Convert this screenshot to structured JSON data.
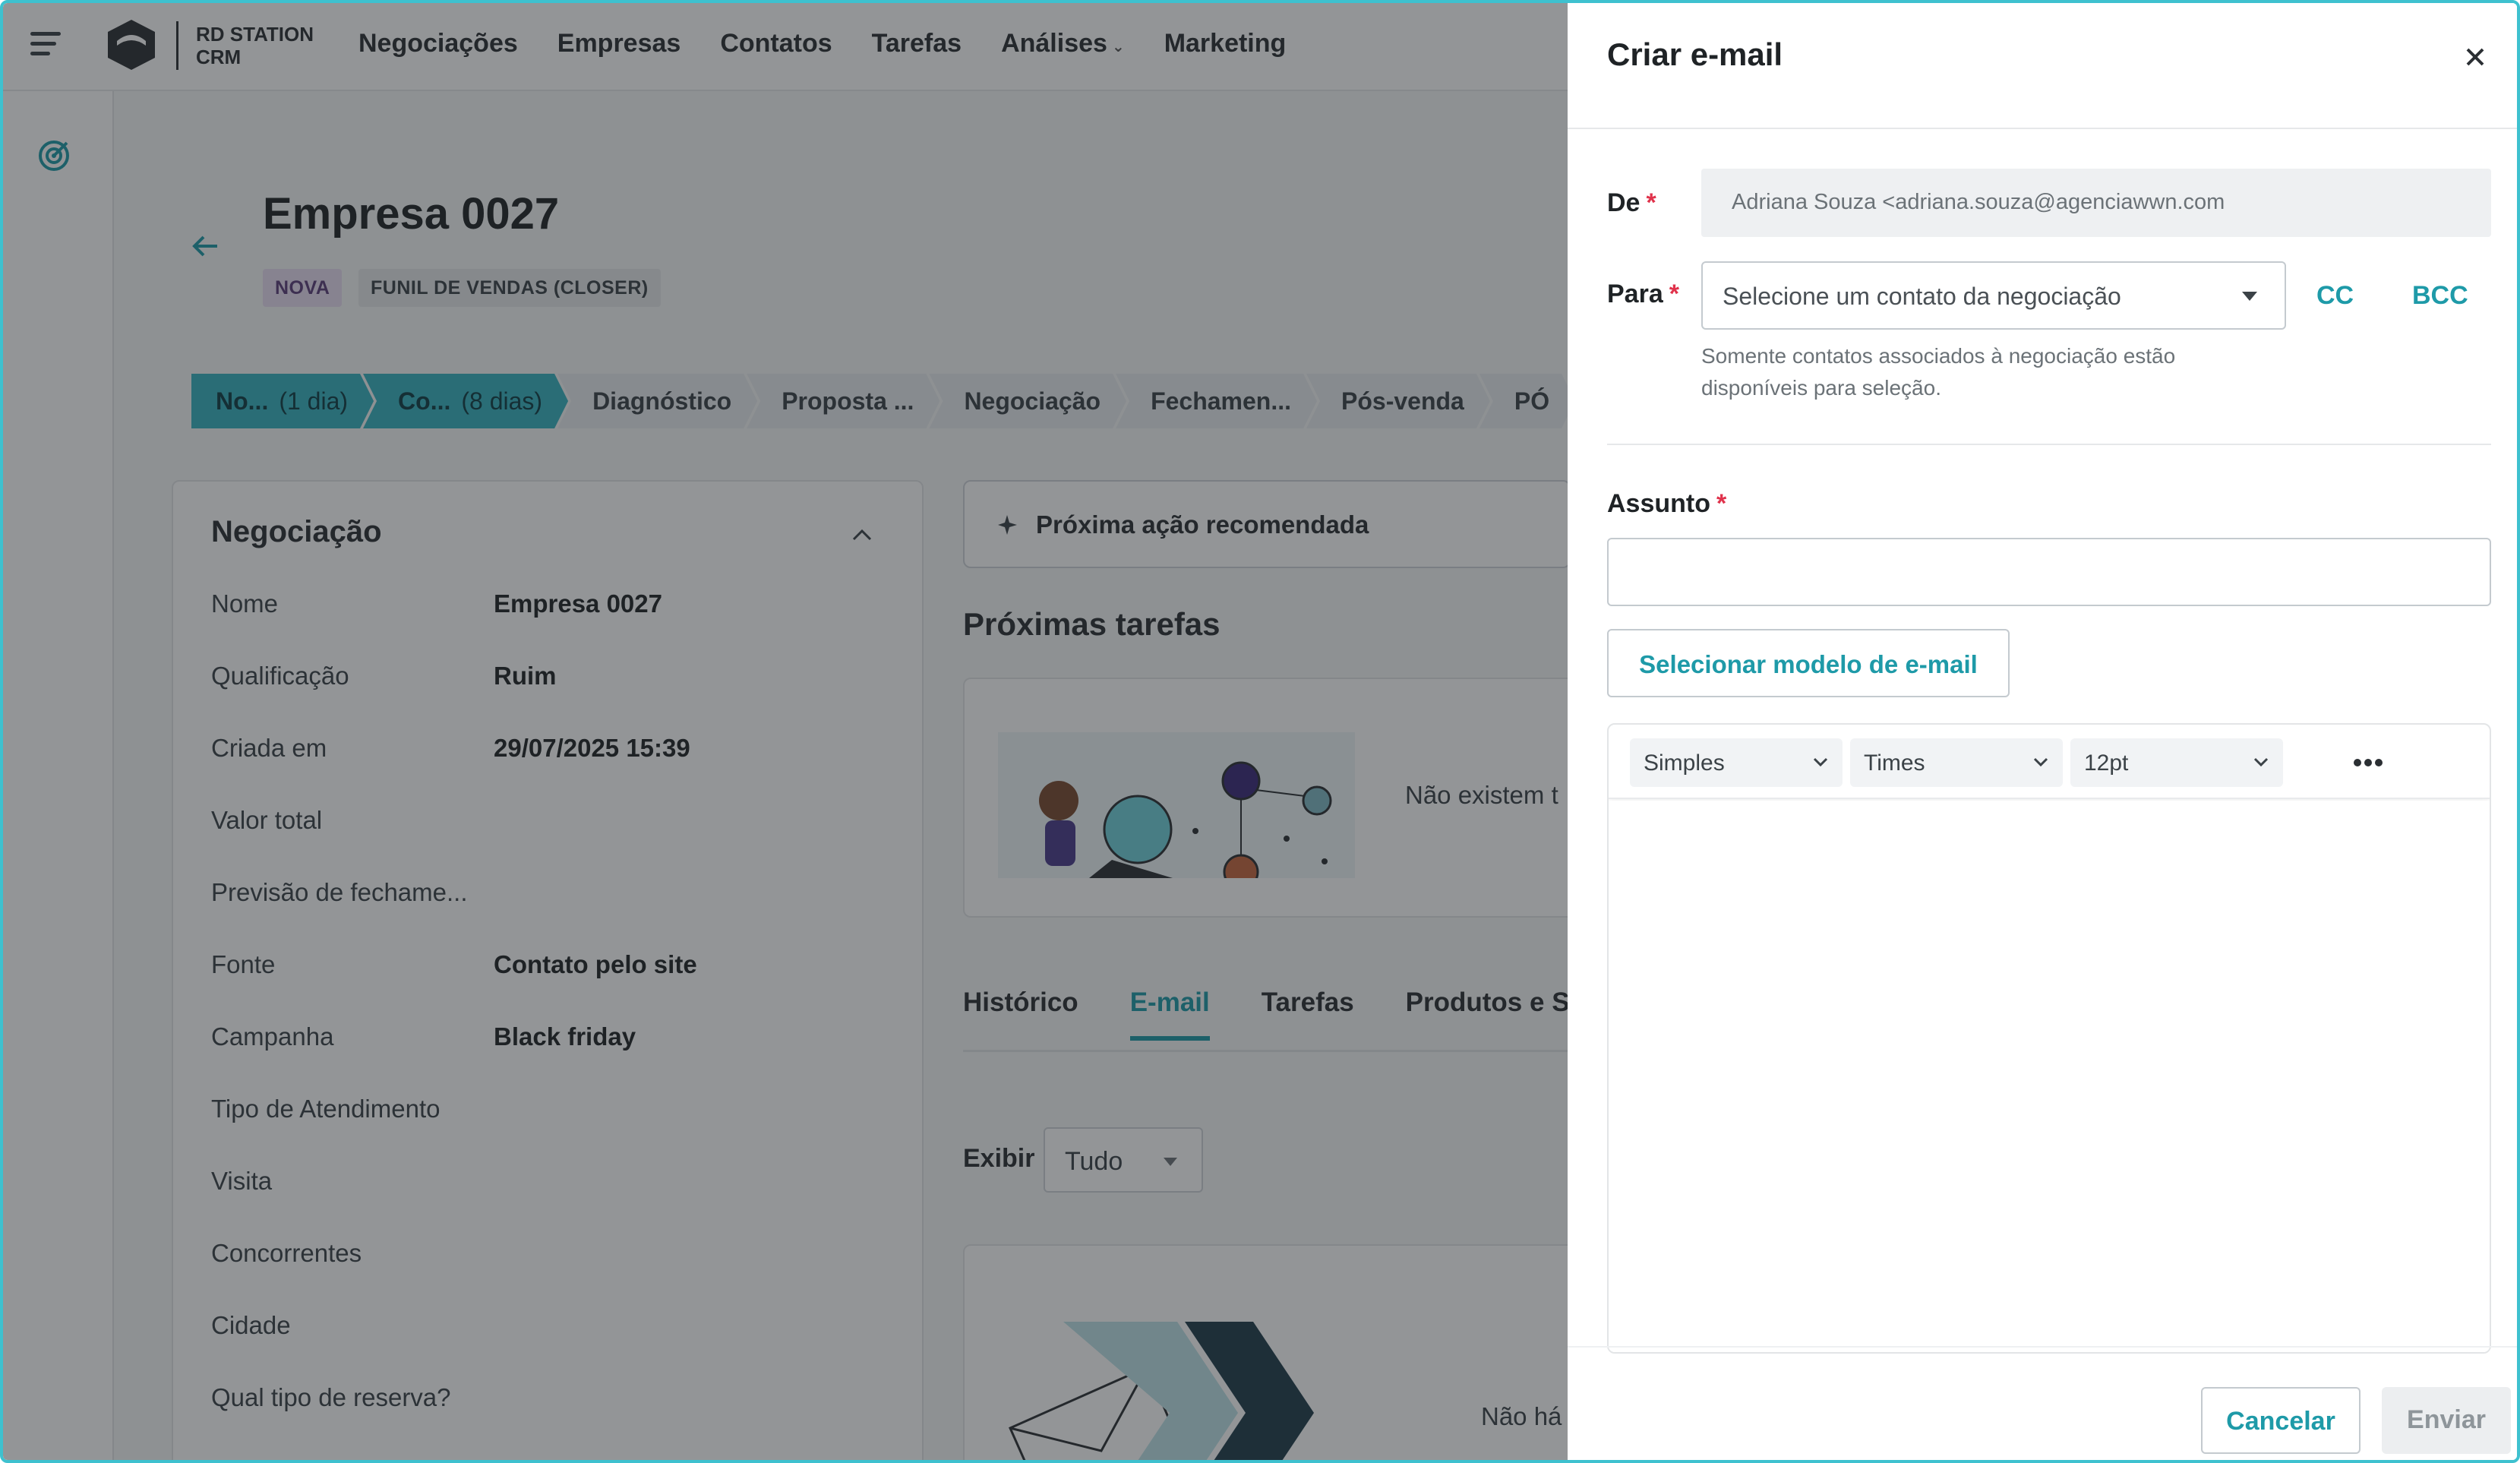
{
  "app": {
    "logo_text": "RD STATION\nCRM",
    "nav": [
      "Negociações",
      "Empresas",
      "Contatos",
      "Tarefas",
      "Análises",
      "Marketing"
    ]
  },
  "deal": {
    "title": "Empresa 0027",
    "tags": [
      "NOVA",
      "FUNIL DE VENDAS (CLOSER)"
    ],
    "stages": [
      {
        "label": "No...",
        "days": "(1 dia)",
        "done": true
      },
      {
        "label": "Co...",
        "days": "(8 dias)",
        "done": true
      },
      {
        "label": "Diagnóstico",
        "days": "",
        "done": false
      },
      {
        "label": "Proposta ...",
        "days": "",
        "done": false
      },
      {
        "label": "Negociação",
        "days": "",
        "done": false
      },
      {
        "label": "Fechamen...",
        "days": "",
        "done": false
      },
      {
        "label": "Pós-venda",
        "days": "",
        "done": false
      },
      {
        "label": "PÓ",
        "days": "",
        "done": false
      }
    ],
    "card_title": "Negociação",
    "fields": [
      {
        "label": "Nome",
        "value": "Empresa 0027"
      },
      {
        "label": "Qualificação",
        "value": "Ruim"
      },
      {
        "label": "Criada em",
        "value": "29/07/2025 15:39"
      },
      {
        "label": "Valor total",
        "value": ""
      },
      {
        "label": "Previsão de fechame...",
        "value": ""
      },
      {
        "label": "Fonte",
        "value": "Contato pelo site"
      },
      {
        "label": "Campanha",
        "value": "Black friday"
      },
      {
        "label": "Tipo de Atendimento",
        "value": ""
      },
      {
        "label": "Visita",
        "value": ""
      },
      {
        "label": "Concorrentes",
        "value": ""
      },
      {
        "label": "Cidade",
        "value": ""
      },
      {
        "label": "Qual tipo de reserva?",
        "value": ""
      }
    ]
  },
  "right": {
    "next_action": "Próxima ação recomendada",
    "next_tasks_title": "Próximas tarefas",
    "tasks_empty": "Não existem t",
    "tabs": [
      "Histórico",
      "E-mail",
      "Tarefas",
      "Produtos e Se"
    ],
    "active_tab": "E-mail",
    "show_label": "Exibir",
    "show_value": "Tudo",
    "email_empty": "Não há"
  },
  "modal": {
    "title": "Criar e-mail",
    "from_label": "De",
    "from_value": "Adriana Souza <adriana.souza@agenciawwn.com",
    "to_label": "Para",
    "to_placeholder": "Selecione um contato da negociação",
    "cc": "CC",
    "bcc": "BCC",
    "helper": "Somente contatos associados à negociação estão disponíveis para seleção.",
    "subject_label": "Assunto",
    "subject_value": "",
    "template_button": "Selecionar modelo de e-mail",
    "toolbar": {
      "format": "Simples",
      "font": "Times",
      "size": "12pt"
    },
    "cancel": "Cancelar",
    "send": "Enviar"
  },
  "colors": {
    "accent": "#1e9aa8",
    "stage_done": "#37b2c0",
    "required": "#e0324b",
    "frame": "#3ec1cf"
  }
}
